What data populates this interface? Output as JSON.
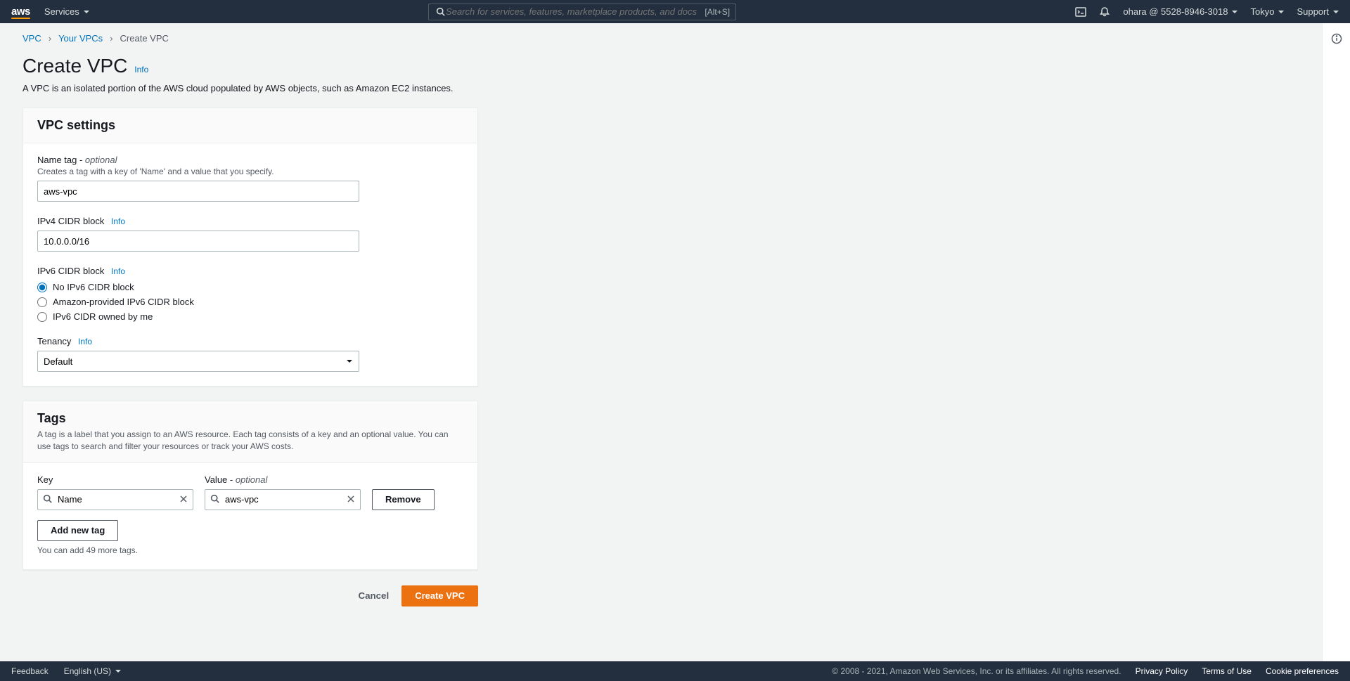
{
  "topnav": {
    "logo": "aws",
    "services": "Services",
    "search_placeholder": "Search for services, features, marketplace products, and docs",
    "search_kb": "[Alt+S]",
    "account": "ohara @ 5528-8946-3018",
    "region": "Tokyo",
    "support": "Support"
  },
  "breadcrumbs": {
    "root": "VPC",
    "mid": "Your VPCs",
    "current": "Create VPC"
  },
  "page": {
    "title": "Create VPC",
    "info": "Info",
    "description": "A VPC is an isolated portion of the AWS cloud populated by AWS objects, such as Amazon EC2 instances."
  },
  "vpc_settings": {
    "header": "VPC settings",
    "name_tag_label": "Name tag - ",
    "name_tag_optional": "optional",
    "name_tag_hint": "Creates a tag with a key of 'Name' and a value that you specify.",
    "name_tag_value": "aws-vpc",
    "ipv4_label": "IPv4 CIDR block",
    "ipv4_value": "10.0.0.0/16",
    "ipv6_label": "IPv6 CIDR block",
    "ipv6_options": {
      "none": "No IPv6 CIDR block",
      "amazon": "Amazon-provided IPv6 CIDR block",
      "owned": "IPv6 CIDR owned by me"
    },
    "tenancy_label": "Tenancy",
    "tenancy_value": "Default",
    "info": "Info"
  },
  "tags": {
    "header": "Tags",
    "description": "A tag is a label that you assign to an AWS resource. Each tag consists of a key and an optional value. You can use tags to search and filter your resources or track your AWS costs.",
    "key_label": "Key",
    "value_label": "Value - ",
    "value_optional": "optional",
    "key_value": "Name",
    "value_value": "aws-vpc",
    "remove": "Remove",
    "add": "Add new tag",
    "limit": "You can add 49 more tags."
  },
  "actions": {
    "cancel": "Cancel",
    "submit": "Create VPC"
  },
  "footer": {
    "feedback": "Feedback",
    "language": "English (US)",
    "copyright": "© 2008 - 2021, Amazon Web Services, Inc. or its affiliates. All rights reserved.",
    "privacy": "Privacy Policy",
    "terms": "Terms of Use",
    "cookies": "Cookie preferences"
  }
}
